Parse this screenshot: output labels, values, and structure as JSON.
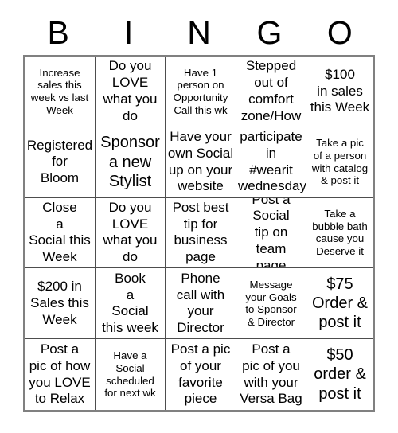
{
  "header": {
    "letters": [
      "B",
      "I",
      "N",
      "G",
      "O"
    ]
  },
  "grid": {
    "columns": 5,
    "rows": 5,
    "cells": [
      {
        "text": "Increase\nsales this\nweek vs last\nWeek",
        "size": "sm"
      },
      {
        "text": "Do you\nLOVE\nwhat you\ndo",
        "size": "md"
      },
      {
        "text": "Have 1\nperson on\nOpportunity\nCall this wk",
        "size": "sm"
      },
      {
        "text": "Stepped\nout of\ncomfort\nzone/How",
        "size": "md"
      },
      {
        "text": "$100\nin sales\nthis Week",
        "size": "md"
      },
      {
        "text": "Registered\nfor\nBloom",
        "size": "md"
      },
      {
        "text": "Sponsor\na new\nStylist",
        "size": "lg"
      },
      {
        "text": "Have your\nown Social\nup on your\nwebsite",
        "size": "md"
      },
      {
        "text": "participate\nin\n#wearit\nwednesday",
        "size": "md"
      },
      {
        "text": "Take a pic\nof a person\nwith catalog\n& post it",
        "size": "sm"
      },
      {
        "text": "Close\na\nSocial this\nWeek",
        "size": "md"
      },
      {
        "text": "Do you\nLOVE\nwhat you\ndo",
        "size": "md"
      },
      {
        "text": "Post best\ntip for\nbusiness\npage",
        "size": "md"
      },
      {
        "text": "Post a\nSocial\ntip on team\npage",
        "size": "md"
      },
      {
        "text": "Take a\nbubble bath\ncause you\nDeserve it",
        "size": "sm"
      },
      {
        "text": "$200 in\nSales this\nWeek",
        "size": "md"
      },
      {
        "text": "Book\na\nSocial\nthis week",
        "size": "md"
      },
      {
        "text": "Phone\ncall with\nyour\nDirector",
        "size": "md"
      },
      {
        "text": "Message\nyour Goals\nto Sponsor\n& Director",
        "size": "sm"
      },
      {
        "text": "$75\nOrder &\npost it",
        "size": "lg"
      },
      {
        "text": "Post a\npic of how\nyou LOVE\nto Relax",
        "size": "md"
      },
      {
        "text": "Have a\nSocial\nscheduled\nfor next wk",
        "size": "sm"
      },
      {
        "text": "Post a pic\nof your\nfavorite\npiece",
        "size": "md"
      },
      {
        "text": "Post a\npic of you\nwith your\nVersa Bag",
        "size": "md"
      },
      {
        "text": "$50\norder &\npost it",
        "size": "lg"
      }
    ]
  },
  "colors": {
    "background": "#ffffff",
    "text": "#000000",
    "grid_line": "#4d4d4d",
    "grid_frame": "#808080"
  }
}
